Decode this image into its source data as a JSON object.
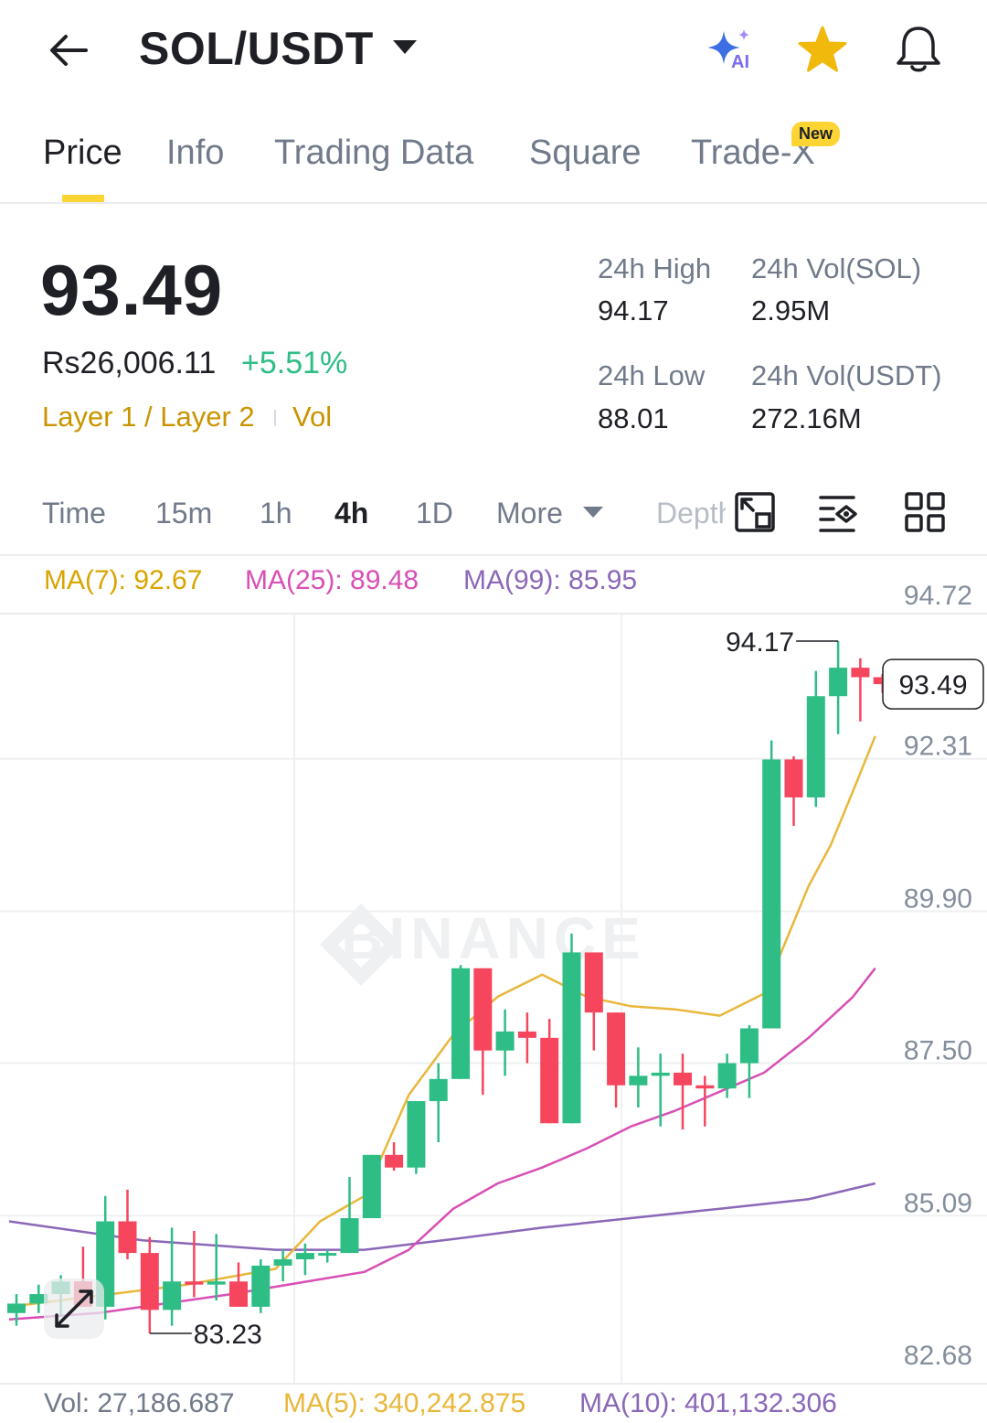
{
  "header": {
    "pair": "SOL/USDT",
    "icons": [
      "back-arrow-icon",
      "dropdown-caret-icon",
      "ai-sparkle-icon",
      "favorite-star-icon",
      "notification-bell-icon"
    ],
    "ai_label": "AI"
  },
  "tabs": [
    {
      "label": "Price",
      "active": true
    },
    {
      "label": "Info"
    },
    {
      "label": "Trading Data"
    },
    {
      "label": "Square"
    },
    {
      "label": "Trade-X",
      "badge": "New"
    }
  ],
  "ticker": {
    "last_price": "93.49",
    "fiat_price": "Rs26,006.11",
    "change_pct": "+5.51%",
    "tags": [
      "Layer 1 / Layer 2",
      "Vol"
    ],
    "stats": {
      "high_label": "24h High",
      "high": "94.17",
      "low_label": "24h Low",
      "low": "88.01",
      "vol_base_label": "24h Vol(SOL)",
      "vol_base": "2.95M",
      "vol_quote_label": "24h Vol(USDT)",
      "vol_quote": "272.16M"
    }
  },
  "intervals": {
    "items": [
      "Time",
      "15m",
      "1h",
      "4h",
      "1D",
      "More"
    ],
    "active": "4h",
    "depth_label": "Depth",
    "tools": [
      "fullscreen-chart-icon",
      "chart-settings-icon",
      "grid-layout-icon"
    ]
  },
  "indicators": {
    "ma7": "MA(7): 92.67",
    "ma25": "MA(25): 89.48",
    "ma99": "MA(99): 85.95"
  },
  "volume": {
    "vol": "Vol: 27,186.687",
    "ma5": "MA(5): 340,242.875",
    "ma10": "MA(10): 401,132.306"
  },
  "colors": {
    "up": "#2ebd85",
    "down": "#f6465d",
    "ma7": "#e9b73a",
    "ma25": "#d84fb5",
    "ma99": "#8b67b8",
    "accent": "#fcd535"
  },
  "chart_data": {
    "type": "candlestick",
    "watermark": "BINANCE",
    "ylim": [
      82.68,
      94.72
    ],
    "y_ticks": [
      "94.72",
      "92.31",
      "89.90",
      "87.50",
      "85.09",
      "82.68"
    ],
    "current_price": "93.49",
    "high_marker": "94.17",
    "low_marker": "83.23",
    "candles": [
      {
        "o": 83.55,
        "h": 83.85,
        "l": 83.35,
        "c": 83.7
      },
      {
        "o": 83.7,
        "h": 84.0,
        "l": 83.55,
        "c": 83.85
      },
      {
        "o": 83.85,
        "h": 84.15,
        "l": 83.5,
        "c": 84.05
      },
      {
        "o": 84.05,
        "h": 84.6,
        "l": 83.7,
        "c": 83.65
      },
      {
        "o": 83.65,
        "h": 85.4,
        "l": 83.45,
        "c": 85.0
      },
      {
        "o": 85.0,
        "h": 85.5,
        "l": 84.4,
        "c": 84.5
      },
      {
        "o": 84.5,
        "h": 84.75,
        "l": 83.23,
        "c": 83.6
      },
      {
        "o": 83.6,
        "h": 84.9,
        "l": 83.35,
        "c": 84.05
      },
      {
        "o": 84.05,
        "h": 84.85,
        "l": 83.8,
        "c": 84.0
      },
      {
        "o": 84.0,
        "h": 84.8,
        "l": 83.75,
        "c": 84.05
      },
      {
        "o": 84.05,
        "h": 84.35,
        "l": 83.75,
        "c": 83.65
      },
      {
        "o": 83.65,
        "h": 84.4,
        "l": 83.55,
        "c": 84.3
      },
      {
        "o": 84.3,
        "h": 84.55,
        "l": 84.05,
        "c": 84.4
      },
      {
        "o": 84.4,
        "h": 84.65,
        "l": 84.15,
        "c": 84.5
      },
      {
        "o": 84.5,
        "h": 84.55,
        "l": 84.35,
        "c": 84.5
      },
      {
        "o": 84.5,
        "h": 85.7,
        "l": 84.5,
        "c": 85.05
      },
      {
        "o": 85.05,
        "h": 85.95,
        "l": 85.1,
        "c": 86.05
      },
      {
        "o": 86.05,
        "h": 86.25,
        "l": 85.8,
        "c": 85.85
      },
      {
        "o": 85.85,
        "h": 86.85,
        "l": 85.75,
        "c": 86.9
      },
      {
        "o": 86.9,
        "h": 87.5,
        "l": 86.25,
        "c": 87.25
      },
      {
        "o": 87.25,
        "h": 89.05,
        "l": 87.25,
        "c": 89.0
      },
      {
        "o": 89.0,
        "h": 89.0,
        "l": 87.0,
        "c": 87.7
      },
      {
        "o": 87.7,
        "h": 88.35,
        "l": 87.3,
        "c": 88.0
      },
      {
        "o": 88.0,
        "h": 88.3,
        "l": 87.5,
        "c": 87.9
      },
      {
        "o": 87.9,
        "h": 88.2,
        "l": 87.15,
        "c": 86.55
      },
      {
        "o": 86.55,
        "h": 89.55,
        "l": 86.55,
        "c": 89.25
      },
      {
        "o": 89.25,
        "h": 89.25,
        "l": 87.7,
        "c": 88.3
      },
      {
        "o": 88.3,
        "h": 88.05,
        "l": 86.8,
        "c": 87.15
      },
      {
        "o": 87.15,
        "h": 87.75,
        "l": 86.8,
        "c": 87.3
      },
      {
        "o": 87.3,
        "h": 87.65,
        "l": 86.5,
        "c": 87.35
      },
      {
        "o": 87.35,
        "h": 87.65,
        "l": 86.45,
        "c": 87.15
      },
      {
        "o": 87.15,
        "h": 87.3,
        "l": 86.5,
        "c": 87.1
      },
      {
        "o": 87.1,
        "h": 87.65,
        "l": 86.95,
        "c": 87.5
      },
      {
        "o": 87.5,
        "h": 88.1,
        "l": 86.95,
        "c": 88.05
      },
      {
        "o": 88.05,
        "h": 92.6,
        "l": 88.05,
        "c": 92.3
      },
      {
        "o": 92.3,
        "h": 92.35,
        "l": 91.25,
        "c": 91.7
      },
      {
        "o": 91.7,
        "h": 93.7,
        "l": 91.55,
        "c": 93.3
      },
      {
        "o": 93.3,
        "h": 94.17,
        "l": 92.7,
        "c": 93.75
      },
      {
        "o": 93.75,
        "h": 93.9,
        "l": 92.9,
        "c": 93.6
      },
      {
        "o": 93.6,
        "h": 93.65,
        "l": 93.35,
        "c": 93.49
      }
    ],
    "ma7": [
      [
        0,
        83.65
      ],
      [
        8,
        84.0
      ],
      [
        12,
        84.25
      ],
      [
        14,
        85.0
      ],
      [
        16,
        85.4
      ],
      [
        18,
        87.0
      ],
      [
        20,
        87.95
      ],
      [
        22,
        88.55
      ],
      [
        24,
        88.9
      ],
      [
        26,
        88.55
      ],
      [
        28,
        88.4
      ],
      [
        30,
        88.35
      ],
      [
        32,
        88.25
      ],
      [
        34,
        88.6
      ],
      [
        36,
        90.3
      ],
      [
        38,
        91.8
      ],
      [
        37,
        90.95
      ],
      [
        39,
        92.67
      ]
    ],
    "ma25": [
      [
        0,
        83.45
      ],
      [
        4,
        83.55
      ],
      [
        10,
        83.85
      ],
      [
        16,
        84.2
      ],
      [
        18,
        84.55
      ],
      [
        20,
        85.2
      ],
      [
        22,
        85.6
      ],
      [
        24,
        85.85
      ],
      [
        26,
        86.15
      ],
      [
        28,
        86.5
      ],
      [
        30,
        86.75
      ],
      [
        32,
        87.05
      ],
      [
        34,
        87.35
      ],
      [
        36,
        87.9
      ],
      [
        38,
        88.55
      ],
      [
        39,
        89.0
      ]
    ],
    "ma99": [
      [
        0,
        85.0
      ],
      [
        6,
        84.7
      ],
      [
        12,
        84.55
      ],
      [
        16,
        84.55
      ],
      [
        20,
        84.72
      ],
      [
        24,
        84.9
      ],
      [
        28,
        85.05
      ],
      [
        32,
        85.2
      ],
      [
        36,
        85.35
      ],
      [
        39,
        85.6
      ]
    ]
  }
}
